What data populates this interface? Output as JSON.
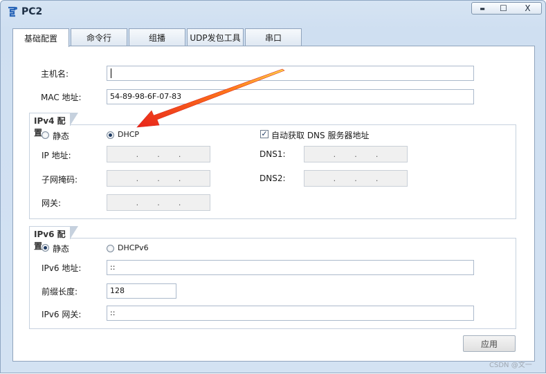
{
  "window": {
    "title": "PC2",
    "minimize_glyph": "▬",
    "maximize_glyph": "☐",
    "close_glyph": "X"
  },
  "tabs": [
    "基础配置",
    "命令行",
    "组播",
    "UDP发包工具",
    "串口"
  ],
  "basic": {
    "hostname_label": "主机名:",
    "hostname_value": "",
    "mac_label": "MAC 地址:",
    "mac_value": "54-89-98-6F-07-83"
  },
  "ipv4": {
    "group_title": "IPv4 配置",
    "static_label": "静态",
    "dhcp_label": "DHCP",
    "selected_mode": "DHCP",
    "auto_dns_label": "自动获取 DNS 服务器地址",
    "auto_dns_checked": true,
    "ip_label": "IP 地址:",
    "mask_label": "子网掩码:",
    "gateway_label": "网关:",
    "dns1_label": "DNS1:",
    "dns2_label": "DNS2:",
    "dot": "."
  },
  "ipv6": {
    "group_title": "IPv6 配置",
    "static_label": "静态",
    "dhcp_label": "DHCPv6",
    "selected_mode": "静态",
    "address_label": "IPv6 地址:",
    "address_value": "::",
    "prefix_label": "前缀长度:",
    "prefix_value": "128",
    "gateway_label": "IPv6 网关:",
    "gateway_value": "::"
  },
  "apply_button": "应用",
  "watermark": "CSDN @文一",
  "colors": {
    "arrow": "#e8251b",
    "accent": "#1f3b63"
  }
}
